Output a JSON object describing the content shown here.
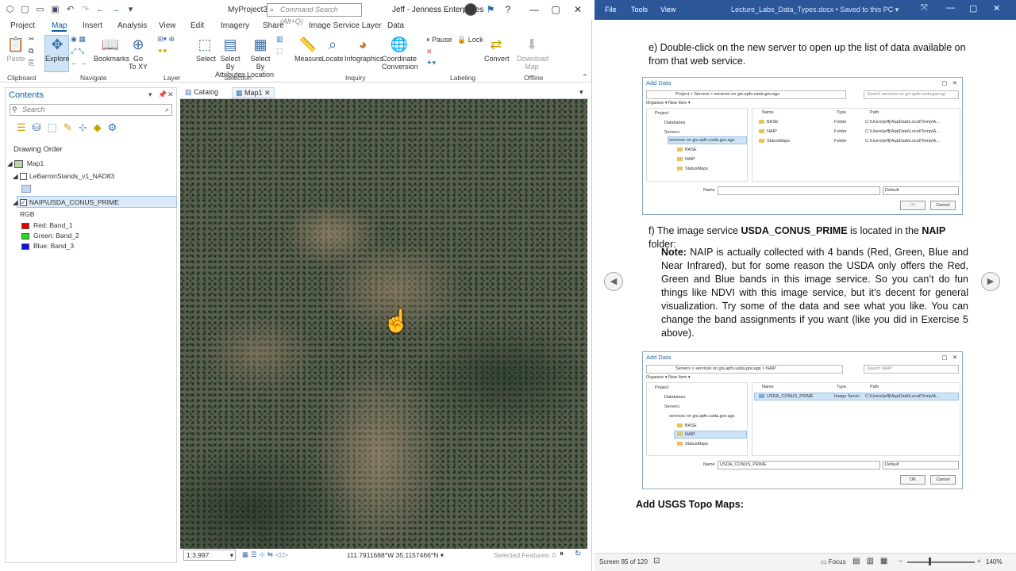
{
  "arcgis": {
    "project_name": "MyProject3",
    "search_placeholder": "Command Search (Alt+Q)",
    "user": "Jeff - Jenness Enterprises",
    "tabs": [
      "Project",
      "Map",
      "Insert",
      "Analysis",
      "View",
      "Edit",
      "Imagery",
      "Share",
      "Image Service Layer",
      "Data"
    ],
    "active_tab": "Map",
    "ribbon": {
      "clipboard_paste": "Paste",
      "explore": "Explore",
      "bookmarks": "Bookmarks",
      "goto": "Go\nTo XY",
      "goto_l1": "Go",
      "goto_l2": "To XY",
      "select": "Select",
      "select_by_attr_l1": "Select By",
      "select_by_attr_l2": "Attributes",
      "select_by_loc_l1": "Select By",
      "select_by_loc_l2": "Location",
      "measure": "Measure",
      "locate": "Locate",
      "infographics": "Infographics",
      "coord_l1": "Coordinate",
      "coord_l2": "Conversion",
      "pause": "Pause",
      "lock": "Lock",
      "convert": "Convert",
      "download_l1": "Download",
      "download_l2": "Map",
      "groups": [
        "Clipboard",
        "Navigate",
        "Layer",
        "Selection",
        "Inquiry",
        "Labeling",
        "Offline"
      ]
    },
    "contents": {
      "title": "Contents",
      "search_placeholder": "Search",
      "drawing_order": "Drawing Order",
      "map_name": "Map1",
      "layer1": "LeBarronStands_v1_NAD83",
      "layer2": "NAIP\\USDA_CONUS_PRIME",
      "rgb_label": "RGB",
      "bands": [
        {
          "label": "Red:  Band_1",
          "color": "#e00000"
        },
        {
          "label": "Green: Band_2",
          "color": "#22e022"
        },
        {
          "label": "Blue:  Band_3",
          "color": "#1010e0"
        }
      ]
    },
    "view_tabs": [
      "Catalog",
      "Map1"
    ],
    "status": {
      "scale": "1:3,997",
      "coordinates": "111.7911688°W 35.1157466°N",
      "selected_features": "Selected Features: 0"
    }
  },
  "word": {
    "menu": [
      "File",
      "Tools",
      "View"
    ],
    "doc_title": "Lecture_Labs_Data_Types.docx • Saved to this PC",
    "step_e": "e)  Double-click on the new server to open up the list of data available on from that web service.",
    "step_f_prefix": "f)  The image service ",
    "step_f_bold1": "USDA_CONUS_PRIME",
    "step_f_mid": " is located in the ",
    "step_f_bold2": "NAIP",
    "step_f_suffix": " folder:",
    "note_label": "Note:",
    "note_text": "  NAIP is actually collected with 4 bands (Red, Green, Blue and Near Infrared), but for some reason the USDA only offers the Red, Green and Blue bands in this image service.  So you can’t do fun things like NDVI with this image service, but it’s decent for general visualization.  Try some of the data and see what you like.  You can change the band assignments if you want (like you did in Exercise 5 above).",
    "heading_usgs": "Add USGS Topo Maps:",
    "status": {
      "page": "Screen 85 of 120",
      "focus": "Focus",
      "zoom": "140%"
    },
    "dialog1": {
      "title": "Add Data",
      "path": "Project  >  Servers  >  services on gis.apfo.usda.gov.ags",
      "search": "Search services on gis.apfo.usda.gov.ag",
      "organize": "Organize ▾    New Item ▾",
      "tree": [
        "Project",
        "Databases",
        "Servers",
        "services on gis.apfo.usda.gov.ags",
        "BASE",
        "NAIP",
        "StatusMaps"
      ],
      "cols": [
        "Name",
        "Type",
        "Path"
      ],
      "rows": [
        {
          "name": "BASE",
          "type": "Folder",
          "path": "C:\\Users\\jeffj\\AppData\\Local\\Temp\\A..."
        },
        {
          "name": "NAIP",
          "type": "Folder",
          "path": "C:\\Users\\jeffj\\AppData\\Local\\Temp\\A..."
        },
        {
          "name": "StatusMaps",
          "type": "Folder",
          "path": "C:\\Users\\jeffj\\AppData\\Local\\Temp\\A..."
        }
      ],
      "name_label": "Name",
      "name_value": "",
      "filter": "Default",
      "ok": "OK",
      "cancel": "Cancel"
    },
    "dialog2": {
      "title": "Add Data",
      "path": "Servers  >  services on gis.apfo.usda.gov.ags  >  NAIP",
      "search": "Search NAIP",
      "organize": "Organize ▾    New Item ▾",
      "tree": [
        "Project",
        "Databases",
        "Servers",
        "services on gis.apfo.usda.gov.ags",
        "BASE",
        "NAIP",
        "StatusMaps"
      ],
      "cols": [
        "Name",
        "Type",
        "Path"
      ],
      "rows": [
        {
          "name": "USDA_CONUS_PRIME",
          "type": "Image Servic",
          "path": "C:\\Users\\jeffj\\AppData\\Local\\Temp\\A..."
        }
      ],
      "name_label": "Name",
      "name_value": "USDA_CONUS_PRIME",
      "filter": "Default",
      "ok": "OK",
      "cancel": "Cancel"
    }
  }
}
